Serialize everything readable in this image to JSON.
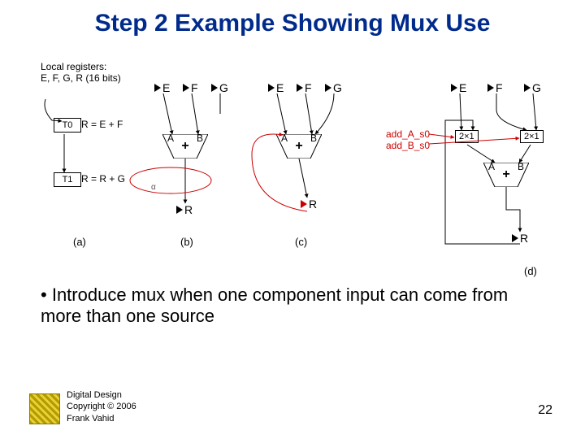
{
  "title": "Step 2 Example Showing Mux Use",
  "local_regs_line1": "Local registers:",
  "local_regs_line2": "E, F, G, R (16 bits)",
  "steps": {
    "t0": {
      "name": "T0",
      "expr": "R = E + F"
    },
    "t1": {
      "name": "T1",
      "expr": "R = R + G"
    }
  },
  "regs": {
    "E": "E",
    "F": "F",
    "G": "G",
    "R": "R"
  },
  "adder": {
    "A": "A",
    "B": "B",
    "plus": "+"
  },
  "mux": {
    "label": "2×1"
  },
  "ctrl": {
    "sA": "add_A_s0",
    "sB": "add_B_s0"
  },
  "sub": {
    "a": "(a)",
    "b": "(b)",
    "c": "(c)",
    "d": "(d)"
  },
  "bullet": "Introduce mux when one component input can come from more than one source",
  "footer": {
    "l1": "Digital Design",
    "l2": "Copyright © 2006",
    "l3": "Frank Vahid"
  },
  "page": "22",
  "alpha": "α"
}
